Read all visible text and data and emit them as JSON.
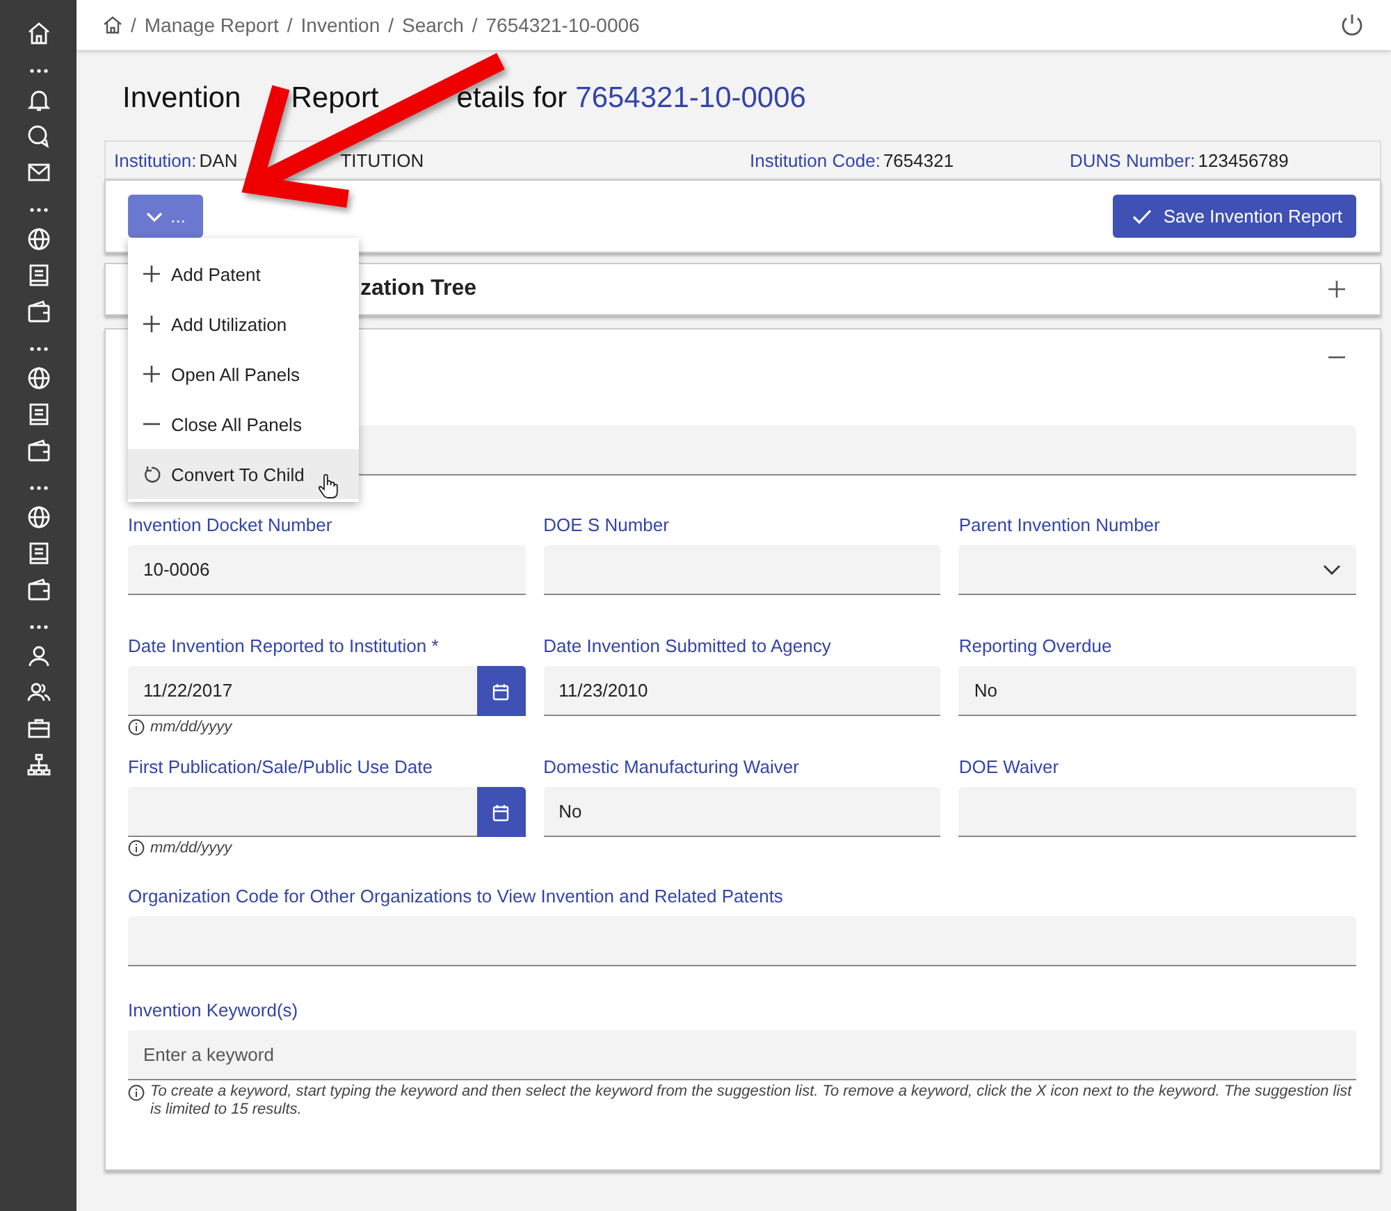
{
  "sidebar": {
    "items": [
      {
        "kind": "home"
      },
      {
        "kind": "dots"
      },
      {
        "kind": "bell"
      },
      {
        "kind": "chat"
      },
      {
        "kind": "mail"
      },
      {
        "kind": "dots"
      },
      {
        "kind": "globe"
      },
      {
        "kind": "book"
      },
      {
        "kind": "wallet"
      },
      {
        "kind": "dots"
      },
      {
        "kind": "globe"
      },
      {
        "kind": "book"
      },
      {
        "kind": "wallet"
      },
      {
        "kind": "dots"
      },
      {
        "kind": "globe"
      },
      {
        "kind": "book"
      },
      {
        "kind": "wallet"
      },
      {
        "kind": "dots"
      },
      {
        "kind": "person"
      },
      {
        "kind": "people"
      },
      {
        "kind": "briefcase"
      },
      {
        "kind": "org"
      }
    ]
  },
  "breadcrumb": [
    {
      "separator": "/",
      "label": "Manage Report"
    },
    {
      "separator": "/",
      "label": "Invention"
    },
    {
      "separator": "/",
      "label": "Search"
    },
    {
      "separator": "/",
      "label": "7654321-10-0006"
    }
  ],
  "title": {
    "parts": [
      "Invention",
      "Report",
      "etails for"
    ],
    "id": "7654321-10-0006"
  },
  "info_bar": {
    "institution_label": "Institution:",
    "institution_value_parts": [
      "DAN",
      "TITUTION"
    ],
    "code_label": "Institution Code:",
    "code_value": "7654321",
    "duns_label": "DUNS Number:",
    "duns_value": "123456789"
  },
  "toolbar": {
    "dropdown_label": "...",
    "save_label": "Save Invention Report"
  },
  "menu": [
    {
      "kind": "plus",
      "label": "Add Patent",
      "hovered": false
    },
    {
      "kind": "plus",
      "label": "Add Utilization",
      "hovered": false
    },
    {
      "kind": "plus",
      "label": "Open All Panels",
      "hovered": false
    },
    {
      "kind": "minus",
      "label": "Close All Panels",
      "hovered": false
    },
    {
      "kind": "undo",
      "label": "Convert To Child",
      "hovered": true
    }
  ],
  "panels": [
    {
      "title": "zation Tree",
      "expanded": false
    },
    {
      "expanded": true
    }
  ],
  "form": {
    "rows": [
      [
        {
          "label": "Invention Docket Number",
          "kind": "text",
          "value": "10-0006"
        },
        {
          "label": "DOE S Number",
          "kind": "text"
        },
        {
          "label": "Parent Invention Number",
          "kind": "select"
        }
      ],
      [
        {
          "label": "Date Invention Reported to Institution *",
          "kind": "date",
          "value": "11/22/2017",
          "hint": "mm/dd/yyyy"
        },
        {
          "label": "Date Invention Submitted to Agency",
          "kind": "text",
          "value": "11/23/2010"
        },
        {
          "label": "Reporting Overdue",
          "kind": "text",
          "value": "No"
        }
      ],
      [
        {
          "label": "First Publication/Sale/Public Use Date",
          "kind": "date",
          "hint": "mm/dd/yyyy"
        },
        {
          "label": "Domestic Manufacturing Waiver",
          "kind": "text",
          "value": "No"
        },
        {
          "label": "DOE Waiver",
          "kind": "text"
        }
      ]
    ],
    "org_code": {
      "label": "Organization Code for Other Organizations to View Invention and Related Patents"
    },
    "keywords": {
      "label": "Invention Keyword(s)",
      "placeholder": "Enter a keyword",
      "hint": "To create a keyword, start typing the keyword and then select the keyword from the suggestion list. To remove a keyword, click the X icon next to the keyword. The suggestion list is limited to 15 results."
    }
  }
}
